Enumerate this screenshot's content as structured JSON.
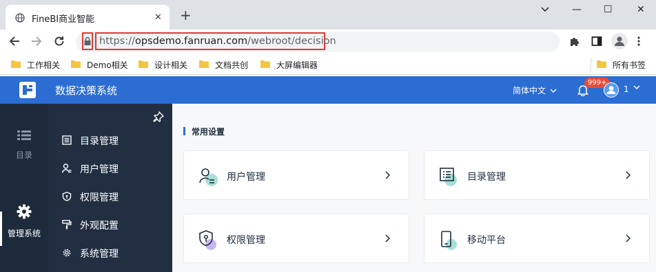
{
  "browser": {
    "tab": {
      "title": "FineBI商业智能",
      "close": "✕"
    },
    "new_tab": "+",
    "window_controls": {
      "minimize": "—",
      "maximize": "☐",
      "close": "✕"
    },
    "address": {
      "scheme": "https://",
      "host": "opsdemo.fanruan.com",
      "path": "/webroot/decision"
    },
    "bookmarks": [
      {
        "label": "工作相关"
      },
      {
        "label": "Demo相关"
      },
      {
        "label": "设计相关"
      },
      {
        "label": "文档共创"
      },
      {
        "label": "大屏编辑器"
      }
    ],
    "bookmarks_other": "所有书签"
  },
  "app": {
    "title": "数据决策系统",
    "language": "简体中文",
    "notifications_badge": "999+",
    "user": "1",
    "brand_color": "#2c6dd4"
  },
  "rail": [
    {
      "label": "目录",
      "icon": "list-icon",
      "active": false
    },
    {
      "label": "管理系统",
      "icon": "gear-icon",
      "active": true
    }
  ],
  "subnav": [
    {
      "label": "目录管理",
      "icon": "catalog-icon"
    },
    {
      "label": "用户管理",
      "icon": "user-icon"
    },
    {
      "label": "权限管理",
      "icon": "shield-icon"
    },
    {
      "label": "外观配置",
      "icon": "paint-icon"
    },
    {
      "label": "系统管理",
      "icon": "gear-icon"
    }
  ],
  "main": {
    "section_title": "常用设置",
    "cards": [
      {
        "label": "用户管理",
        "icon": "user-manage-icon",
        "accent": "#7fd3c3"
      },
      {
        "label": "目录管理",
        "icon": "catalog-manage-icon",
        "accent": "#7fd3c3"
      },
      {
        "label": "权限管理",
        "icon": "permission-manage-icon",
        "accent": "#b7a3f0"
      },
      {
        "label": "移动平台",
        "icon": "mobile-platform-icon",
        "accent": "#7fd3c3"
      }
    ]
  }
}
